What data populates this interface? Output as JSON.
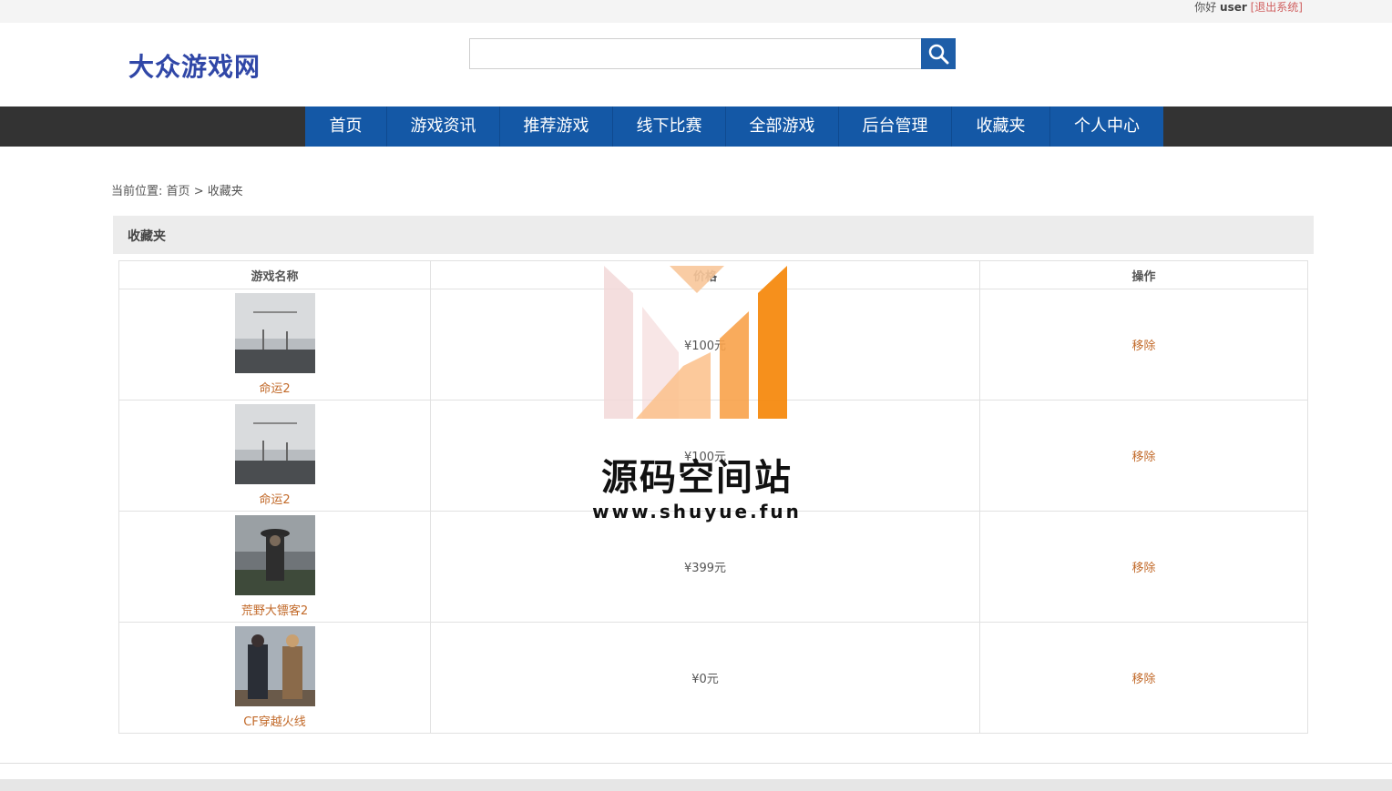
{
  "topbar": {
    "greeting": "你好",
    "username": "user",
    "logout": "[退出系统]"
  },
  "header": {
    "logo": "大众游戏网",
    "search_placeholder": ""
  },
  "nav": [
    "首页",
    "游戏资讯",
    "推荐游戏",
    "线下比赛",
    "全部游戏",
    "后台管理",
    "收藏夹",
    "个人中心"
  ],
  "breadcrumb": {
    "prefix": "当前位置:",
    "home": "首页",
    "sep": ">",
    "current": "收藏夹"
  },
  "panel": {
    "title": "收藏夹"
  },
  "table": {
    "headers": [
      "游戏名称",
      "价格",
      "操作"
    ],
    "rows": [
      {
        "name": "命运2",
        "price": "¥100元",
        "action": "移除"
      },
      {
        "name": "命运2",
        "price": "¥100元",
        "action": "移除"
      },
      {
        "name": "荒野大镖客2",
        "price": "¥399元",
        "action": "移除"
      },
      {
        "name": "CF穿越火线",
        "price": "¥0元",
        "action": "移除"
      }
    ]
  },
  "watermark": {
    "title": "源码空间站",
    "url": "www.shuyue.fun"
  },
  "colors": {
    "nav_bg": "#1458a6",
    "navbar_bg": "#333333",
    "logo": "#3047a7",
    "link": "#c26a2a"
  }
}
